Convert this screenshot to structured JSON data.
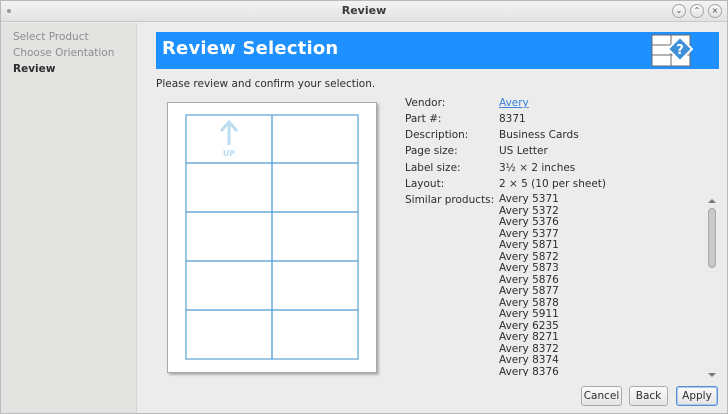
{
  "window": {
    "title": "Review"
  },
  "sidebar": {
    "steps": [
      {
        "label": "Select Product"
      },
      {
        "label": "Choose Orientation"
      },
      {
        "label": "Review"
      }
    ]
  },
  "banner": {
    "title": "Review Selection",
    "icon": "label-sheet-help-icon"
  },
  "intro": "Please review and confirm your selection.",
  "preview": {
    "up_label": "UP",
    "rows": 5,
    "cols": 2
  },
  "details": {
    "vendor_label": "Vendor:",
    "vendor_value": "Avery",
    "part_label": "Part #:",
    "part_value": "8371",
    "description_label": "Description:",
    "description_value": "Business Cards",
    "page_size_label": "Page size:",
    "page_size_value": "US Letter",
    "label_size_label": "Label size:",
    "label_size_value": "3½ × 2 inches",
    "layout_label": "Layout:",
    "layout_value": "2 × 5 (10 per sheet)",
    "similar_label": "Similar products:",
    "similar": [
      "Avery 5371",
      "Avery 5372",
      "Avery 5376",
      "Avery 5377",
      "Avery 5871",
      "Avery 5872",
      "Avery 5873",
      "Avery 5876",
      "Avery 5877",
      "Avery 5878",
      "Avery 5911",
      "Avery 6235",
      "Avery 8271",
      "Avery 8372",
      "Avery 8374",
      "Avery 8376"
    ]
  },
  "buttons": {
    "cancel": "Cancel",
    "back": "Back",
    "apply": "Apply"
  },
  "colors": {
    "accent": "#1e90ff",
    "link": "#3b82d8",
    "label_grid": "#5ba3d6"
  }
}
